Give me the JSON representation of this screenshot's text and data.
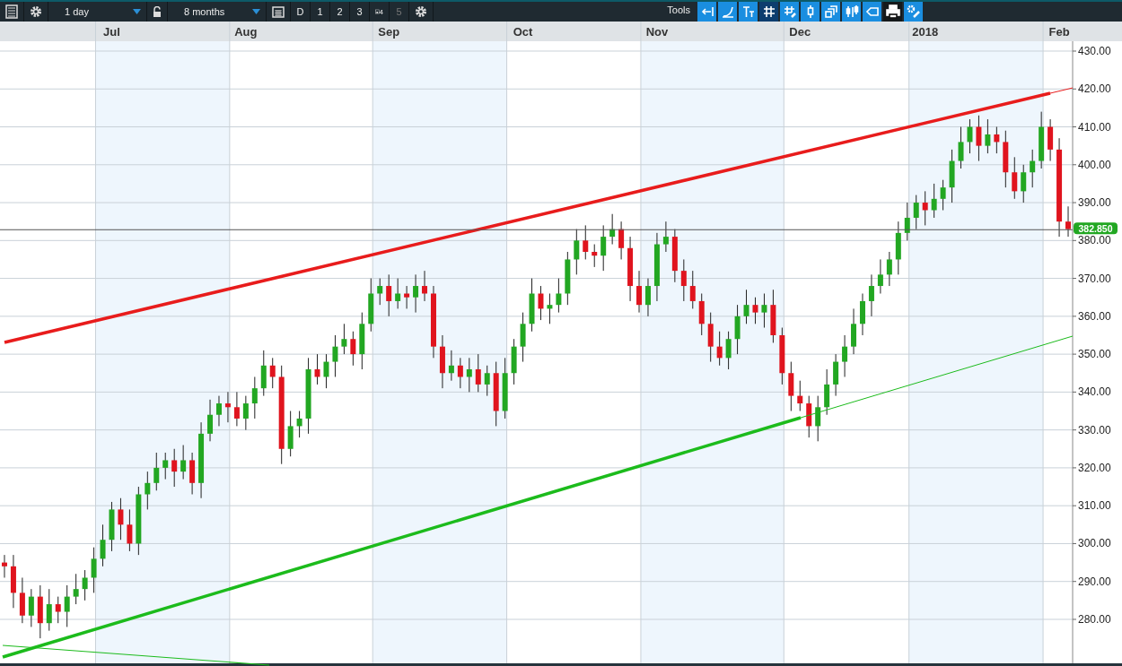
{
  "toolbar": {
    "menu": {
      "kind": "list"
    },
    "interval": {
      "value": "1 day"
    },
    "range": {
      "value": "8 months"
    },
    "periods": [
      {
        "label": "D",
        "kind": "text",
        "disabled": false
      },
      {
        "label": "1",
        "kind": "text",
        "disabled": false
      },
      {
        "label": "2",
        "kind": "text",
        "disabled": false
      },
      {
        "label": "3",
        "kind": "text",
        "disabled": false
      },
      {
        "label": "4",
        "kind": "save",
        "disabled": false
      },
      {
        "label": "5",
        "kind": "text",
        "disabled": true
      }
    ],
    "tools_label": "Tools",
    "tools": [
      {
        "kind": "toggle",
        "selected": false
      },
      {
        "kind": "toggle",
        "selected": false
      },
      {
        "kind": "toggle",
        "selected": false
      },
      {
        "kind": "toggle",
        "selected": true
      },
      {
        "kind": "toggle",
        "selected": false
      },
      {
        "kind": "toggle",
        "selected": false
      },
      {
        "kind": "toggle",
        "selected": false
      },
      {
        "kind": "toggle",
        "selected": false
      },
      {
        "kind": "toggle",
        "selected": false
      },
      {
        "kind": "action",
        "selected": false
      },
      {
        "kind": "toggle",
        "selected": false
      }
    ]
  },
  "chart": {
    "chart_data": {
      "type": "candlestick",
      "categories": [
        null,
        null,
        null,
        null,
        null,
        null,
        null,
        null,
        null,
        null,
        null,
        null,
        "Jul",
        null,
        null,
        null,
        null,
        null,
        null,
        null,
        null,
        null,
        null,
        null,
        null,
        null,
        null,
        "Aug",
        null,
        null,
        null,
        null,
        null,
        null,
        null,
        null,
        null,
        null,
        null,
        null,
        null,
        null,
        null,
        "Sep",
        null,
        null,
        null,
        null,
        null,
        null,
        null,
        null,
        null,
        null,
        null,
        null,
        null,
        null,
        "Oct",
        null,
        null,
        null,
        null,
        null,
        null,
        null,
        null,
        null,
        null,
        null,
        null,
        null,
        null,
        "Nov",
        null,
        null,
        null,
        null,
        null,
        null,
        null,
        null,
        null,
        null,
        null,
        null,
        null,
        null,
        null,
        "Dec",
        null,
        null,
        null,
        null,
        null,
        null,
        null,
        null,
        null,
        null,
        null,
        null,
        null,
        "2018",
        null,
        null,
        null,
        null,
        null,
        null,
        null,
        null,
        null,
        null,
        null,
        null,
        null,
        null,
        "Feb",
        null
      ],
      "ohlc": [
        [
          295,
          297,
          291,
          294
        ],
        [
          294,
          297,
          283,
          287
        ],
        [
          287,
          291,
          279,
          281
        ],
        [
          281,
          288,
          278,
          286
        ],
        [
          286,
          289,
          275,
          279
        ],
        [
          279,
          288,
          277,
          284
        ],
        [
          284,
          286,
          279,
          282
        ],
        [
          282,
          289,
          278,
          286
        ],
        [
          286,
          292,
          284,
          288
        ],
        [
          288,
          293,
          285,
          291
        ],
        [
          291,
          299,
          287,
          296
        ],
        [
          296,
          305,
          294,
          301
        ],
        [
          301,
          311,
          298,
          309
        ],
        [
          309,
          312,
          301,
          305
        ],
        [
          305,
          309,
          298,
          300
        ],
        [
          300,
          315,
          297,
          313
        ],
        [
          313,
          319,
          309,
          316
        ],
        [
          316,
          324,
          314,
          320
        ],
        [
          320,
          324,
          317,
          322
        ],
        [
          322,
          325,
          315,
          319
        ],
        [
          319,
          326,
          317,
          322
        ],
        [
          322,
          324,
          313,
          316
        ],
        [
          316,
          332,
          312,
          329
        ],
        [
          329,
          338,
          327,
          334
        ],
        [
          334,
          339,
          331,
          337
        ],
        [
          337,
          340,
          332,
          336
        ],
        [
          336,
          340,
          331,
          333
        ],
        [
          333,
          339,
          330,
          337
        ],
        [
          337,
          344,
          333,
          341
        ],
        [
          341,
          351,
          339,
          347
        ],
        [
          347,
          349,
          341,
          344
        ],
        [
          344,
          347,
          321,
          325
        ],
        [
          325,
          335,
          323,
          331
        ],
        [
          331,
          335,
          328,
          333
        ],
        [
          333,
          349,
          329,
          346
        ],
        [
          346,
          350,
          342,
          344
        ],
        [
          344,
          350,
          341,
          348
        ],
        [
          348,
          355,
          344,
          352
        ],
        [
          352,
          358,
          350,
          354
        ],
        [
          354,
          356,
          347,
          350
        ],
        [
          350,
          361,
          346,
          358
        ],
        [
          358,
          370,
          356,
          366
        ],
        [
          366,
          370,
          363,
          368
        ],
        [
          368,
          371,
          360,
          364
        ],
        [
          364,
          370,
          362,
          366
        ],
        [
          366,
          368,
          362,
          365
        ],
        [
          365,
          371,
          361,
          368
        ],
        [
          368,
          372,
          364,
          366
        ],
        [
          366,
          368,
          349,
          352
        ],
        [
          352,
          355,
          341,
          345
        ],
        [
          345,
          351,
          343,
          347
        ],
        [
          347,
          349,
          341,
          344
        ],
        [
          344,
          349,
          340,
          346
        ],
        [
          346,
          350,
          340,
          342
        ],
        [
          342,
          347,
          339,
          345
        ],
        [
          345,
          348,
          331,
          335
        ],
        [
          335,
          349,
          333,
          345
        ],
        [
          345,
          354,
          342,
          352
        ],
        [
          352,
          361,
          348,
          358
        ],
        [
          358,
          370,
          356,
          366
        ],
        [
          366,
          368,
          359,
          362
        ],
        [
          362,
          366,
          358,
          363
        ],
        [
          363,
          370,
          361,
          366
        ],
        [
          366,
          377,
          363,
          375
        ],
        [
          375,
          383,
          371,
          380
        ],
        [
          380,
          384,
          375,
          377
        ],
        [
          377,
          379,
          373,
          376
        ],
        [
          376,
          384,
          372,
          381
        ],
        [
          381,
          387,
          379,
          383
        ],
        [
          383,
          385,
          375,
          378
        ],
        [
          378,
          381,
          364,
          368
        ],
        [
          368,
          372,
          361,
          363
        ],
        [
          363,
          370,
          360,
          368
        ],
        [
          368,
          382,
          364,
          379
        ],
        [
          379,
          385,
          377,
          381
        ],
        [
          381,
          383,
          369,
          372
        ],
        [
          372,
          375,
          364,
          368
        ],
        [
          368,
          372,
          362,
          364
        ],
        [
          364,
          366,
          355,
          358
        ],
        [
          358,
          361,
          348,
          352
        ],
        [
          352,
          356,
          347,
          349
        ],
        [
          349,
          356,
          346,
          354
        ],
        [
          354,
          363,
          350,
          360
        ],
        [
          360,
          367,
          358,
          363
        ],
        [
          363,
          365,
          358,
          361
        ],
        [
          361,
          366,
          357,
          363
        ],
        [
          363,
          367,
          353,
          355
        ],
        [
          355,
          357,
          342,
          345
        ],
        [
          345,
          348,
          335,
          339
        ],
        [
          339,
          343,
          335,
          337
        ],
        [
          337,
          339,
          328,
          331
        ],
        [
          331,
          339,
          327,
          336
        ],
        [
          336,
          346,
          334,
          342
        ],
        [
          342,
          350,
          339,
          348
        ],
        [
          348,
          355,
          344,
          352
        ],
        [
          352,
          362,
          350,
          358
        ],
        [
          358,
          366,
          355,
          364
        ],
        [
          364,
          371,
          360,
          368
        ],
        [
          368,
          375,
          366,
          371
        ],
        [
          371,
          377,
          368,
          375
        ],
        [
          375,
          385,
          371,
          382
        ],
        [
          382,
          390,
          380,
          386
        ],
        [
          386,
          392,
          383,
          390
        ],
        [
          390,
          393,
          384,
          388
        ],
        [
          388,
          395,
          386,
          391
        ],
        [
          391,
          396,
          388,
          394
        ],
        [
          394,
          404,
          390,
          401
        ],
        [
          401,
          410,
          399,
          406
        ],
        [
          406,
          412,
          403,
          410
        ],
        [
          410,
          413,
          401,
          405
        ],
        [
          405,
          412,
          403,
          408
        ],
        [
          408,
          410,
          403,
          406
        ],
        [
          406,
          409,
          394,
          398
        ],
        [
          398,
          402,
          391,
          393
        ],
        [
          393,
          400,
          390,
          398
        ],
        [
          398,
          404,
          394,
          401
        ],
        [
          401,
          414,
          399,
          410
        ],
        [
          410,
          412,
          401,
          404
        ],
        [
          404,
          407,
          381,
          385
        ],
        [
          385,
          389,
          381,
          383
        ]
      ],
      "ylim": [
        268.4,
        432.6
      ],
      "grid": true,
      "yticks": [
        {
          "value": 280,
          "label": "280.00"
        },
        {
          "value": 290,
          "label": "290.00"
        },
        {
          "value": 300,
          "label": "300.00"
        },
        {
          "value": 310,
          "label": "310.00"
        },
        {
          "value": 320,
          "label": "320.00"
        },
        {
          "value": 330,
          "label": "330.00"
        },
        {
          "value": 340,
          "label": "340.00"
        },
        {
          "value": 350,
          "label": "350.00"
        },
        {
          "value": 360,
          "label": "360.00"
        },
        {
          "value": 370,
          "label": "370.00"
        },
        {
          "value": 380,
          "label": "380.00"
        },
        {
          "value": 390,
          "label": "390.00"
        },
        {
          "value": 400,
          "label": "400.00"
        },
        {
          "value": 410,
          "label": "410.00"
        },
        {
          "value": 420,
          "label": "420.00"
        },
        {
          "value": 430,
          "label": "430.00"
        }
      ],
      "orientation": "vertical"
    },
    "current_price": {
      "label": "382.850"
    }
  }
}
